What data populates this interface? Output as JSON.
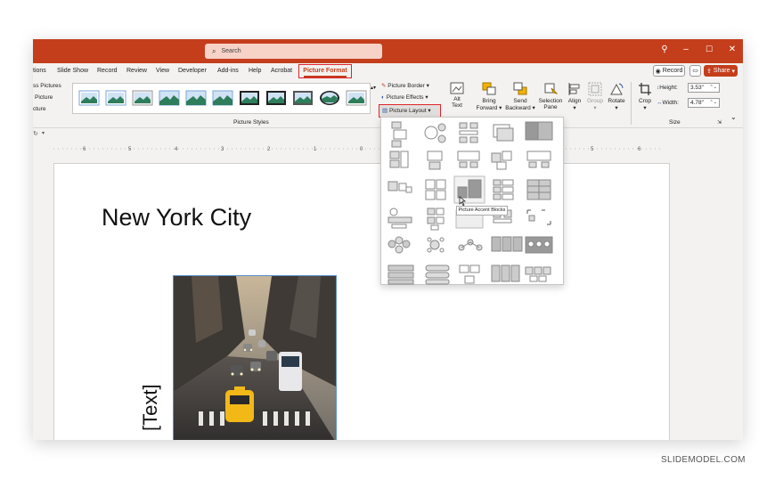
{
  "titlebar": {
    "search_placeholder": "Search"
  },
  "menubar": {
    "tabs": [
      "tions",
      "Slide Show",
      "Record",
      "Review",
      "View",
      "Developer",
      "Add-ins",
      "Help",
      "Acrobat"
    ],
    "active_tab": "Picture Format",
    "record_label": "Record",
    "share_label": "Share"
  },
  "ribbon": {
    "left_items": [
      "ss Pictures",
      "Picture",
      "cture"
    ],
    "group_picture_styles": "Picture Styles",
    "picture_border": "Picture Border",
    "picture_effects": "Picture Effects",
    "picture_layout": "Picture Layout",
    "alt_text": [
      "Alt",
      "Text"
    ],
    "bring_forward": [
      "Bring",
      "Forward"
    ],
    "send_backward": [
      "Send",
      "Backward"
    ],
    "selection_pane": [
      "Selection",
      "Pane"
    ],
    "align": "Align",
    "group": "Group",
    "rotate": "Rotate",
    "crop": "Crop",
    "height_label": "Height:",
    "height_value": "3.53\"",
    "width_label": "Width:",
    "width_value": "4.78\"",
    "group_size": "Size"
  },
  "ruler": {
    "labels": [
      "6",
      "5",
      "4",
      "3",
      "2",
      "1",
      "0",
      "5",
      "6"
    ]
  },
  "slide": {
    "title": "New York City",
    "text_placeholder": "[Text]"
  },
  "dropdown": {
    "tooltip": "Picture Accent Blocks"
  },
  "watermark": "SLIDEMODEL.COM",
  "colors": {
    "accent": "#c43e1c",
    "highlight": "#e0242c"
  },
  "icons": {
    "search": "magnifier-icon",
    "lightbulb": "lightbulb-icon",
    "minimize": "minimize-icon",
    "maximize": "maximize-icon",
    "close": "close-icon"
  }
}
